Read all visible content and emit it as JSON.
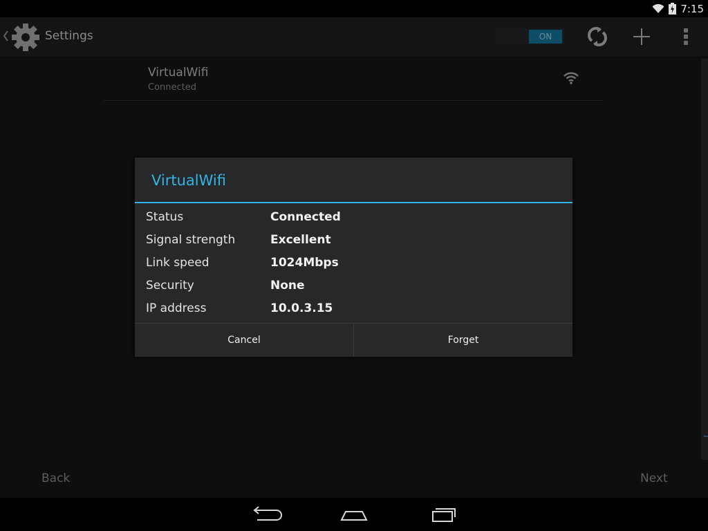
{
  "status_bar": {
    "time": "7:15",
    "icons": [
      "wifi-icon",
      "battery-charging-icon"
    ]
  },
  "action_bar": {
    "title": "Settings",
    "toggle_label": "ON",
    "actions": [
      "scan-icon",
      "add-network-icon",
      "overflow-menu-icon"
    ]
  },
  "wifi_list": {
    "items": [
      {
        "name": "VirtualWifi",
        "status": "Connected",
        "signal_icon": "wifi-signal-icon"
      }
    ]
  },
  "wizard_nav": {
    "back_label": "Back",
    "next_label": "Next"
  },
  "dialog": {
    "title": "VirtualWifi",
    "rows": [
      {
        "label": "Status",
        "value": "Connected"
      },
      {
        "label": "Signal strength",
        "value": "Excellent"
      },
      {
        "label": "Link speed",
        "value": "1024Mbps"
      },
      {
        "label": "Security",
        "value": "None"
      },
      {
        "label": "IP address",
        "value": "10.0.3.15"
      }
    ],
    "cancel_label": "Cancel",
    "forget_label": "Forget"
  },
  "colors": {
    "accent": "#33b5e5",
    "toggle_on": "#0e4d66"
  },
  "nav_bar": {
    "buttons": [
      "back-nav-icon",
      "home-nav-icon",
      "recents-nav-icon"
    ]
  }
}
